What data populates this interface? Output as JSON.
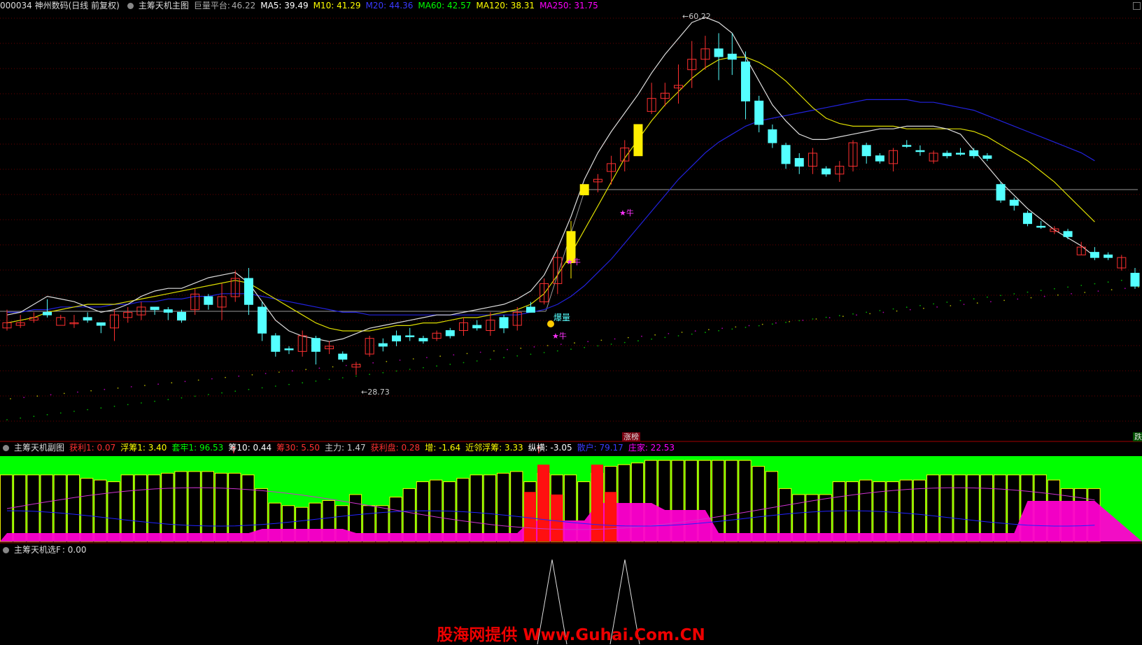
{
  "main": {
    "code_name": "000034 神州数码(日线 前复权)",
    "indicator": "主筹天机主图",
    "platform": {
      "label": "巨量平台:",
      "value": "46.22"
    },
    "mas": [
      {
        "label": "MA5:",
        "value": "39.49",
        "color": "#ffffff"
      },
      {
        "label": "M10:",
        "value": "41.29",
        "color": "#ffff00"
      },
      {
        "label": "M20:",
        "value": "44.36",
        "color": "#3a3aff"
      },
      {
        "label": "MA60:",
        "value": "42.57",
        "color": "#00ff00"
      },
      {
        "label": "MA120:",
        "value": "38.31",
        "color": "#ffff00"
      },
      {
        "label": "MA250:",
        "value": "31.75",
        "color": "#ff00ff"
      }
    ],
    "high_label": "60.22",
    "low_label": "28.73",
    "signal_labels": {
      "niu": "★牛",
      "bao": "爆量"
    },
    "zhangbang": "涨榜",
    "right_tag": "跌"
  },
  "sub": {
    "name": "主筹天机副图",
    "items": [
      {
        "label": "获利1:",
        "value": "0.07",
        "color": "#ff3030"
      },
      {
        "label": "浮筹1:",
        "value": "3.40",
        "color": "#ffff00"
      },
      {
        "label": "套牢1:",
        "value": "96.53",
        "color": "#00ff00"
      },
      {
        "label": "筹10:",
        "value": "0.44",
        "color": "#ffffff"
      },
      {
        "label": "筹30:",
        "value": "5.50",
        "color": "#ff3030"
      },
      {
        "label": "主力:",
        "value": "1.47",
        "color": "#cccccc"
      },
      {
        "label": "获利盘:",
        "value": "0.28",
        "color": "#ff3030"
      },
      {
        "label": "增:",
        "value": "-1.64",
        "color": "#ffff00"
      },
      {
        "label": "近邻浮筹:",
        "value": "3.33",
        "color": "#ffff00"
      },
      {
        "label": "纵横:",
        "value": "-3.05",
        "color": "#ffffff"
      },
      {
        "label": "散户:",
        "value": "79.17",
        "color": "#3a3aff"
      },
      {
        "label": "庄家:",
        "value": "22.53",
        "color": "#ff00ff"
      }
    ]
  },
  "selector": {
    "name": "主筹天机选F",
    "value": ": 0.00"
  },
  "watermark": "股海网提供 Www.Guhai.Com.CN",
  "chart_data": {
    "type": "candlestick",
    "candles": [
      [
        25,
        27,
        32,
        24,
        "u"
      ],
      [
        27,
        26,
        30,
        25,
        "u"
      ],
      [
        28,
        29,
        31,
        27,
        "u"
      ],
      [
        31,
        30,
        29,
        36,
        "d"
      ],
      [
        29,
        26,
        28,
        30,
        "u"
      ],
      [
        27,
        27,
        30,
        25,
        "u"
      ],
      [
        28,
        29,
        31,
        27,
        "d"
      ],
      [
        26,
        27,
        27,
        23,
        "d"
      ],
      [
        25,
        30,
        32,
        20,
        "u"
      ],
      [
        29,
        31,
        33,
        27,
        "u"
      ],
      [
        30,
        33,
        35,
        28,
        "u"
      ],
      [
        33,
        32,
        33,
        30,
        "d"
      ],
      [
        31,
        32,
        33,
        28,
        "d"
      ],
      [
        28,
        31,
        32,
        27,
        "d"
      ],
      [
        32,
        38,
        40,
        30,
        "u"
      ],
      [
        37,
        34,
        38,
        32,
        "d"
      ],
      [
        33,
        37,
        42,
        28,
        "u"
      ],
      [
        37,
        44,
        47,
        35,
        "u"
      ],
      [
        44,
        34,
        48,
        30,
        "d"
      ],
      [
        33,
        23,
        35,
        20,
        "d"
      ],
      [
        22,
        16,
        23,
        14,
        "d"
      ],
      [
        17,
        17,
        18,
        15,
        "d"
      ],
      [
        16,
        22,
        24,
        14,
        "u"
      ],
      [
        21,
        16,
        22,
        11,
        "d"
      ],
      [
        17,
        18,
        20,
        15,
        "u"
      ],
      [
        15,
        13,
        16,
        12,
        "d"
      ],
      [
        11,
        10,
        12,
        7,
        "u"
      ],
      [
        15,
        21,
        22,
        14,
        "u"
      ],
      [
        18,
        19,
        21,
        16,
        "d"
      ],
      [
        20,
        22,
        24,
        18,
        "d"
      ],
      [
        22,
        22,
        25,
        20,
        "d"
      ],
      [
        21,
        20,
        22,
        19,
        "d"
      ],
      [
        21,
        23,
        24,
        20,
        "u"
      ],
      [
        24,
        22,
        25,
        21,
        "d"
      ],
      [
        24,
        27,
        29,
        22,
        "u"
      ],
      [
        26,
        25,
        28,
        24,
        "d"
      ],
      [
        24,
        28,
        31,
        22,
        "u"
      ],
      [
        29,
        25,
        30,
        23,
        "d"
      ],
      [
        26,
        31,
        33,
        24,
        "u"
      ],
      [
        31,
        33,
        35,
        31,
        "d"
      ],
      [
        35,
        42,
        44,
        34,
        "u"
      ],
      [
        42,
        52,
        55,
        38,
        "u"
      ],
      [
        50,
        62,
        66,
        44,
        "yellow"
      ],
      [
        76,
        80,
        80,
        76,
        "yellow"
      ],
      [
        81,
        82,
        84,
        77,
        "u"
      ],
      [
        85,
        88,
        91,
        80,
        "u"
      ],
      [
        89,
        94,
        97,
        85,
        "u"
      ],
      [
        91,
        103,
        103,
        91,
        "yellow"
      ],
      [
        108,
        113,
        119,
        107,
        "u"
      ],
      [
        113,
        115,
        119,
        110,
        "u"
      ],
      [
        117,
        118,
        126,
        111,
        "u"
      ],
      [
        124,
        128,
        135,
        117,
        "u"
      ],
      [
        128,
        132,
        137,
        124,
        "u"
      ],
      [
        132,
        129,
        138,
        120,
        "d"
      ],
      [
        130,
        128,
        138,
        122,
        "d"
      ],
      [
        127,
        112,
        131,
        105,
        "d"
      ],
      [
        112,
        103,
        114,
        100,
        "d"
      ],
      [
        101,
        96,
        103,
        94,
        "d"
      ],
      [
        95,
        88,
        96,
        86,
        "d"
      ],
      [
        90,
        87,
        92,
        84,
        "d"
      ],
      [
        92,
        87,
        94,
        84,
        "u"
      ],
      [
        86,
        84,
        87,
        83,
        "d"
      ],
      [
        84,
        87,
        89,
        81,
        "u"
      ],
      [
        87,
        96,
        97,
        85,
        "u"
      ],
      [
        95,
        91,
        96,
        88,
        "d"
      ],
      [
        91,
        89,
        92,
        88,
        "d"
      ],
      [
        88,
        93,
        94,
        85,
        "u"
      ],
      [
        95,
        95,
        97,
        94,
        "d"
      ],
      [
        93,
        93,
        95,
        91,
        "d"
      ],
      [
        89,
        92,
        93,
        88,
        "u"
      ],
      [
        91,
        92,
        93,
        90,
        "d"
      ],
      [
        92,
        92,
        94,
        91,
        "d"
      ],
      [
        93,
        91,
        94,
        90,
        "d"
      ],
      [
        91,
        90,
        92,
        89,
        "d"
      ],
      [
        80,
        74,
        81,
        73,
        "d"
      ],
      [
        74,
        72,
        75,
        70,
        "d"
      ],
      [
        69,
        65,
        70,
        64,
        "d"
      ],
      [
        64,
        64,
        66,
        63,
        "d"
      ],
      [
        62,
        63,
        64,
        61,
        "u"
      ],
      [
        62,
        60,
        63,
        59,
        "d"
      ],
      [
        56,
        53,
        58,
        53,
        "u"
      ],
      [
        54,
        52,
        56,
        51,
        "d"
      ],
      [
        52,
        53,
        54,
        51,
        "d"
      ],
      [
        52,
        48,
        53,
        47,
        "u"
      ],
      [
        46,
        41,
        48,
        40,
        "d"
      ]
    ],
    "ma5": [
      0.21,
      0.22,
      0.25,
      0.28,
      0.27,
      0.26,
      0.24,
      0.22,
      0.23,
      0.25,
      0.28,
      0.3,
      0.31,
      0.31,
      0.33,
      0.35,
      0.36,
      0.37,
      0.33,
      0.26,
      0.19,
      0.15,
      0.13,
      0.12,
      0.11,
      0.12,
      0.14,
      0.16,
      0.17,
      0.18,
      0.19,
      0.2,
      0.21,
      0.21,
      0.22,
      0.23,
      0.24,
      0.25,
      0.27,
      0.3,
      0.36,
      0.46,
      0.58,
      0.72,
      0.82,
      0.9,
      0.97,
      1.04,
      1.12,
      1.19,
      1.25,
      1.31,
      1.33,
      1.31,
      1.27,
      1.18,
      1.09,
      1.0,
      0.94,
      0.89,
      0.87,
      0.87,
      0.88,
      0.89,
      0.9,
      0.91,
      0.91,
      0.92,
      0.92,
      0.92,
      0.91,
      0.89,
      0.83,
      0.77,
      0.71,
      0.66,
      0.61,
      0.57,
      0.53,
      0.5,
      0.47,
      0.43
    ],
    "ma10": [
      0.18,
      0.19,
      0.2,
      0.22,
      0.23,
      0.24,
      0.25,
      0.25,
      0.25,
      0.26,
      0.27,
      0.28,
      0.29,
      0.3,
      0.31,
      0.32,
      0.33,
      0.34,
      0.33,
      0.3,
      0.27,
      0.24,
      0.21,
      0.18,
      0.16,
      0.15,
      0.15,
      0.15,
      0.16,
      0.17,
      0.17,
      0.18,
      0.18,
      0.19,
      0.2,
      0.2,
      0.21,
      0.22,
      0.23,
      0.25,
      0.29,
      0.36,
      0.44,
      0.53,
      0.62,
      0.71,
      0.8,
      0.87,
      0.94,
      1.0,
      1.05,
      1.1,
      1.14,
      1.17,
      1.18,
      1.18,
      1.16,
      1.13,
      1.09,
      1.04,
      0.99,
      0.95,
      0.93,
      0.92,
      0.92,
      0.92,
      0.92,
      0.91,
      0.91,
      0.91,
      0.91,
      0.91,
      0.9,
      0.88,
      0.85,
      0.82,
      0.79,
      0.75,
      0.71,
      0.66,
      0.61,
      0.56
    ],
    "ma20": [
      0.22,
      0.22,
      0.23,
      0.23,
      0.24,
      0.24,
      0.24,
      0.24,
      0.25,
      0.25,
      0.26,
      0.26,
      0.27,
      0.27,
      0.28,
      0.28,
      0.29,
      0.29,
      0.29,
      0.28,
      0.27,
      0.26,
      0.25,
      0.24,
      0.23,
      0.22,
      0.22,
      0.21,
      0.21,
      0.21,
      0.21,
      0.21,
      0.21,
      0.21,
      0.21,
      0.21,
      0.21,
      0.21,
      0.21,
      0.22,
      0.23,
      0.25,
      0.28,
      0.32,
      0.37,
      0.42,
      0.48,
      0.54,
      0.6,
      0.66,
      0.72,
      0.77,
      0.82,
      0.86,
      0.89,
      0.92,
      0.94,
      0.95,
      0.96,
      0.97,
      0.98,
      0.99,
      1.0,
      1.01,
      1.02,
      1.02,
      1.02,
      1.02,
      1.01,
      1.01,
      1.0,
      0.99,
      0.98,
      0.96,
      0.94,
      0.92,
      0.9,
      0.88,
      0.86,
      0.84,
      0.82,
      0.79
    ],
    "platform_line": 46.22,
    "sub_bars": [
      0.78,
      0.78,
      0.78,
      0.78,
      0.78,
      0.78,
      0.74,
      0.72,
      0.7,
      0.78,
      0.78,
      0.78,
      0.8,
      0.82,
      0.82,
      0.82,
      0.8,
      0.8,
      0.78,
      0.62,
      0.45,
      0.42,
      0.4,
      0.45,
      0.48,
      0.42,
      0.55,
      0.42,
      0.42,
      0.52,
      0.62,
      0.7,
      0.72,
      0.7,
      0.74,
      0.78,
      0.78,
      0.8,
      0.82,
      0.7,
      0.8,
      0.78,
      0.78,
      0.7,
      0.8,
      0.88,
      0.9,
      0.92,
      0.95,
      0.95,
      0.95,
      0.95,
      0.95,
      0.95,
      0.95,
      0.95,
      0.88,
      0.82,
      0.62,
      0.55,
      0.55,
      0.55,
      0.7,
      0.7,
      0.72,
      0.7,
      0.7,
      0.72,
      0.72,
      0.78,
      0.78,
      0.78,
      0.78,
      0.78,
      0.78,
      0.78,
      0.78,
      0.78,
      0.72,
      0.62,
      0.62,
      0.62
    ]
  }
}
